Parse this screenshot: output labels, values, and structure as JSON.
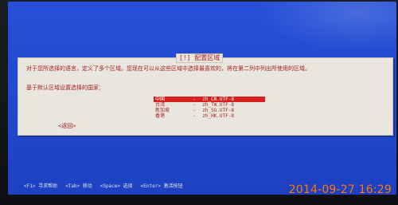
{
  "dialog": {
    "title": "[!] 配置区域",
    "instructions": "对于您所选择的语言，定义了多个区域。您现在可以从这些区域中选择最喜欢的，将在第二列中列出所使用的区域。",
    "prompt": "基于默认区域设置选择的国家：",
    "locales": [
      {
        "name": "中国",
        "dash": "-",
        "locale": "zh_CN.UTF-8",
        "selected": true
      },
      {
        "name": "台湾",
        "dash": "-",
        "locale": "zh_TW.UTF-8",
        "selected": false
      },
      {
        "name": "新加坡",
        "dash": "-",
        "locale": "zh_SG.UTF-8",
        "selected": false
      },
      {
        "name": "香港",
        "dash": "-",
        "locale": "zh_HK.UTF-8",
        "selected": false
      }
    ],
    "back_label": "<返回>"
  },
  "bottombar": {
    "items": [
      "<F1> 寻求帮助",
      "<Tab> 移动",
      "<Space> 选择",
      "<Enter> 激活按钮"
    ]
  },
  "overlay": {
    "timestamp": "2014-09-27  16:29"
  },
  "colors": {
    "screen_blue": "#1f46c8",
    "dialog_bg": "#e9e6df",
    "text_red": "#a51f1f",
    "selection_red": "#d62020",
    "timestamp_orange": "#ff7b18"
  }
}
